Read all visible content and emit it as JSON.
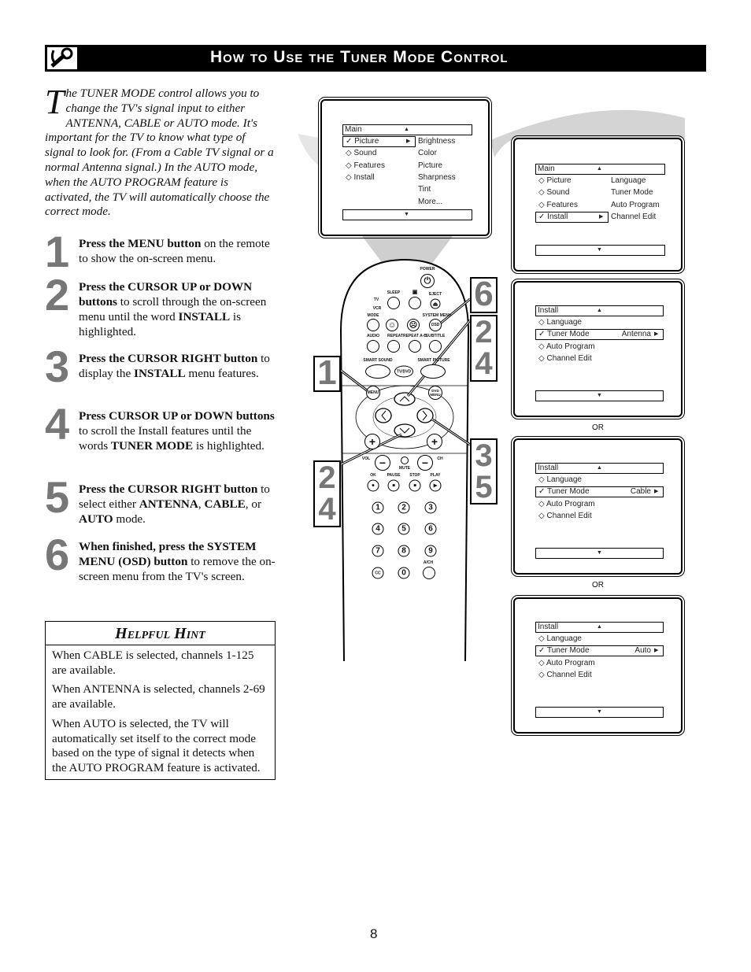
{
  "header": {
    "title": "How to Use the Tuner Mode Control",
    "icon": "wrench-icon"
  },
  "intro": {
    "dropcap": "T",
    "text": "he TUNER MODE control allows you to change the TV's signal input to either ANTENNA, CABLE or AUTO mode. It's important for the TV to know what type of signal to look for. (From a Cable TV signal or a normal Antenna signal.) In the AUTO mode, when the AUTO PROGRAM feature is activated, the TV will automatically choose the correct mode."
  },
  "steps": [
    {
      "num": "1",
      "bold": "Press the MENU button",
      "text": " on the remote to show the on-screen menu."
    },
    {
      "num": "2",
      "bold": "Press the CURSOR UP or DOWN buttons",
      "text": " to scroll through the on-screen menu until the word ",
      "bold2": "INSTALL",
      "text2": " is highlighted."
    },
    {
      "num": "3",
      "bold": "Press the CURSOR RIGHT button",
      "text": " to display the ",
      "bold2": "INSTALL",
      "text2": " menu features."
    },
    {
      "num": "4",
      "bold": "Press CURSOR UP or DOWN buttons",
      "text": " to scroll the Install features until the words ",
      "bold2": "TUNER MODE",
      "text2": " is highlighted."
    },
    {
      "num": "5",
      "bold": "Press the CURSOR RIGHT button",
      "text": " to select either ",
      "bold2": "ANTENNA",
      "text2": ", ",
      "bold3": "CABLE",
      "text3": ", or ",
      "bold4": "AUTO",
      "text4": " mode."
    },
    {
      "num": "6",
      "bold": "When finished, press the SYSTEM MENU (OSD) button",
      "text": " to remove the on-screen menu from the TV's screen."
    }
  ],
  "hint": {
    "title": "Helpful Hint",
    "paragraphs": [
      "When CABLE is selected, channels 1-125 are available.",
      "When ANTENNA is selected, channels 2-69 are available.",
      "When AUTO is selected, the TV will automatically set itself to the correct mode based on the type of signal it detects when the AUTO PROGRAM feature is activated."
    ]
  },
  "screens": [
    {
      "header": "Main",
      "left": [
        "Picture",
        "Sound",
        "Features",
        "Install"
      ],
      "selected": 0,
      "right": [
        "Brightness",
        "Color",
        "Picture",
        "Sharpness",
        "Tint",
        "More..."
      ]
    },
    {
      "header": "Main",
      "left": [
        "Picture",
        "Sound",
        "Features",
        "Install"
      ],
      "selected": 3,
      "right": [
        "Language",
        "Tuner Mode",
        "Auto Program",
        "Channel Edit"
      ]
    },
    {
      "header": "Install",
      "left": [
        "Language",
        "Tuner Mode",
        "Auto Program",
        "Channel Edit"
      ],
      "selected": 1,
      "value": "Antenna"
    },
    {
      "header": "Install",
      "left": [
        "Language",
        "Tuner Mode",
        "Auto Program",
        "Channel Edit"
      ],
      "selected": 1,
      "value": "Cable"
    },
    {
      "header": "Install",
      "left": [
        "Language",
        "Tuner Mode",
        "Auto Program",
        "Channel Edit"
      ],
      "selected": 1,
      "value": "Auto"
    }
  ],
  "or_label": "OR",
  "remote": {
    "power": "POWER",
    "sleep": "SLEEP",
    "eject": "EJECT",
    "tv": "TV",
    "vcr": "VCR",
    "mode": "MODE",
    "system_menu": "SYSTEM MENU",
    "osd": "OSD",
    "audio": "AUDIO",
    "repeat": "REPEAT",
    "repeat_ab": "REPEAT A-B",
    "subtitle": "SUBTITLE",
    "smart_sound": "SMART SOUND",
    "smart_picture": "SMART PICTURE",
    "tvdvd": "TV/DVD",
    "menu": "MENU",
    "dvd_menu": "DVD MENU",
    "vol": "VOL",
    "ch": "CH",
    "mute": "MUTE",
    "ok": "OK",
    "pause": "PAUSE",
    "stop": "STOP",
    "play": "PLAY",
    "digits": [
      "1",
      "2",
      "3",
      "4",
      "5",
      "6",
      "7",
      "8",
      "9"
    ],
    "cc": "CC",
    "zero": "0",
    "ach": "A/CH"
  },
  "callouts": {
    "c1": "1",
    "c6": "6",
    "c24a": "2\n4",
    "c24b": "2\n4",
    "c35": "3\n5"
  },
  "page_number": "8"
}
